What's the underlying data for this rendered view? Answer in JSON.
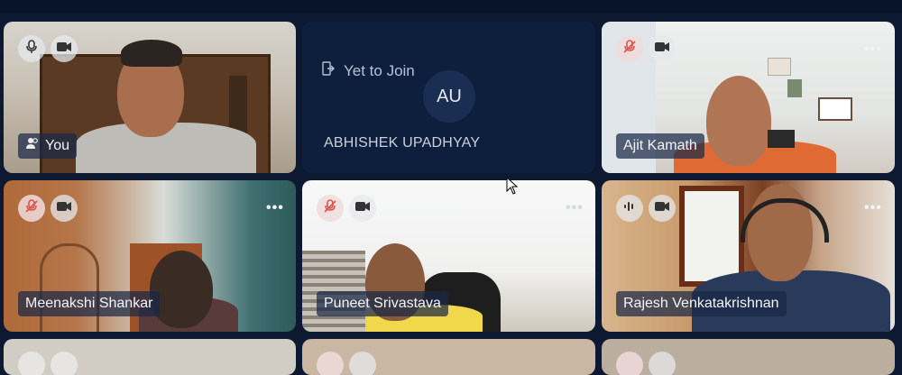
{
  "participants": [
    {
      "name": "You",
      "mic": "on",
      "camera": "on"
    },
    {
      "name": "ABHISHEK UPADHYAY",
      "status": "Yet to Join",
      "initials": "AU"
    },
    {
      "name": "Ajit Kamath",
      "mic": "off",
      "camera": "on"
    },
    {
      "name": "Meenakshi Shankar",
      "mic": "off",
      "camera": "on"
    },
    {
      "name": "Puneet Srivastava",
      "mic": "off",
      "camera": "on"
    },
    {
      "name": "Rajesh Venkatakrishnan",
      "mic": "speaking",
      "camera": "on"
    }
  ],
  "icons": {
    "mic": "microphone-icon",
    "mic_off": "microphone-off-icon",
    "camera": "video-camera-icon",
    "more": "more-options-icon",
    "join": "exit-join-icon",
    "you": "people-icon",
    "speaking": "audio-wave-icon"
  },
  "colors": {
    "background": "#0c1931",
    "name_tag": "#1a2846",
    "mic_off": "#e06060"
  }
}
